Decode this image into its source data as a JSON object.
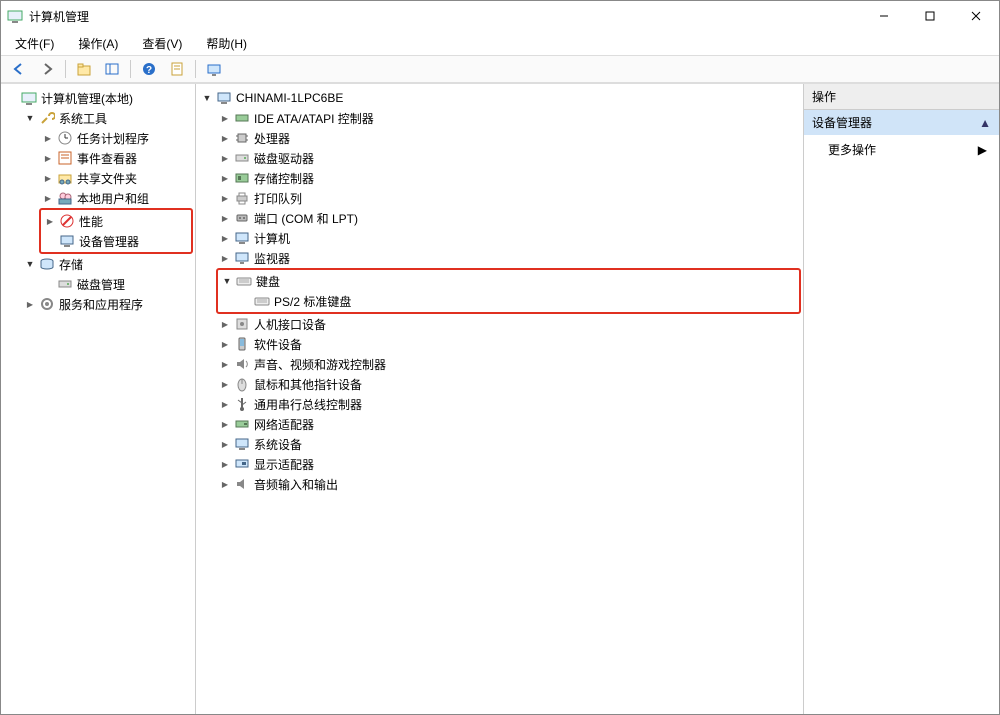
{
  "window": {
    "title": "计算机管理"
  },
  "menu": {
    "file": "文件(F)",
    "action": "操作(A)",
    "view": "查看(V)",
    "help": "帮助(H)"
  },
  "left_tree": {
    "root": "计算机管理(本地)",
    "system_tools": "系统工具",
    "task_scheduler": "任务计划程序",
    "event_viewer": "事件查看器",
    "shared_folders": "共享文件夹",
    "local_users": "本地用户和组",
    "performance": "性能",
    "device_manager": "设备管理器",
    "storage": "存储",
    "disk_management": "磁盘管理",
    "services_apps": "服务和应用程序"
  },
  "center_tree": {
    "computer": "CHINAMI-1LPC6BE",
    "ide_atapi": "IDE ATA/ATAPI 控制器",
    "processors": "处理器",
    "disk_drives": "磁盘驱动器",
    "storage_controllers": "存储控制器",
    "print_queues": "打印队列",
    "ports": "端口 (COM 和 LPT)",
    "computers": "计算机",
    "monitors": "监视器",
    "keyboards": "键盘",
    "ps2_keyboard": "PS/2 标准键盘",
    "hid": "人机接口设备",
    "software_devices": "软件设备",
    "sound": "声音、视频和游戏控制器",
    "mice": "鼠标和其他指针设备",
    "usb": "通用串行总线控制器",
    "network": "网络适配器",
    "system_devices": "系统设备",
    "display": "显示适配器",
    "audio_io": "音频输入和输出"
  },
  "right": {
    "header": "操作",
    "band": "设备管理器",
    "more_actions": "更多操作"
  }
}
